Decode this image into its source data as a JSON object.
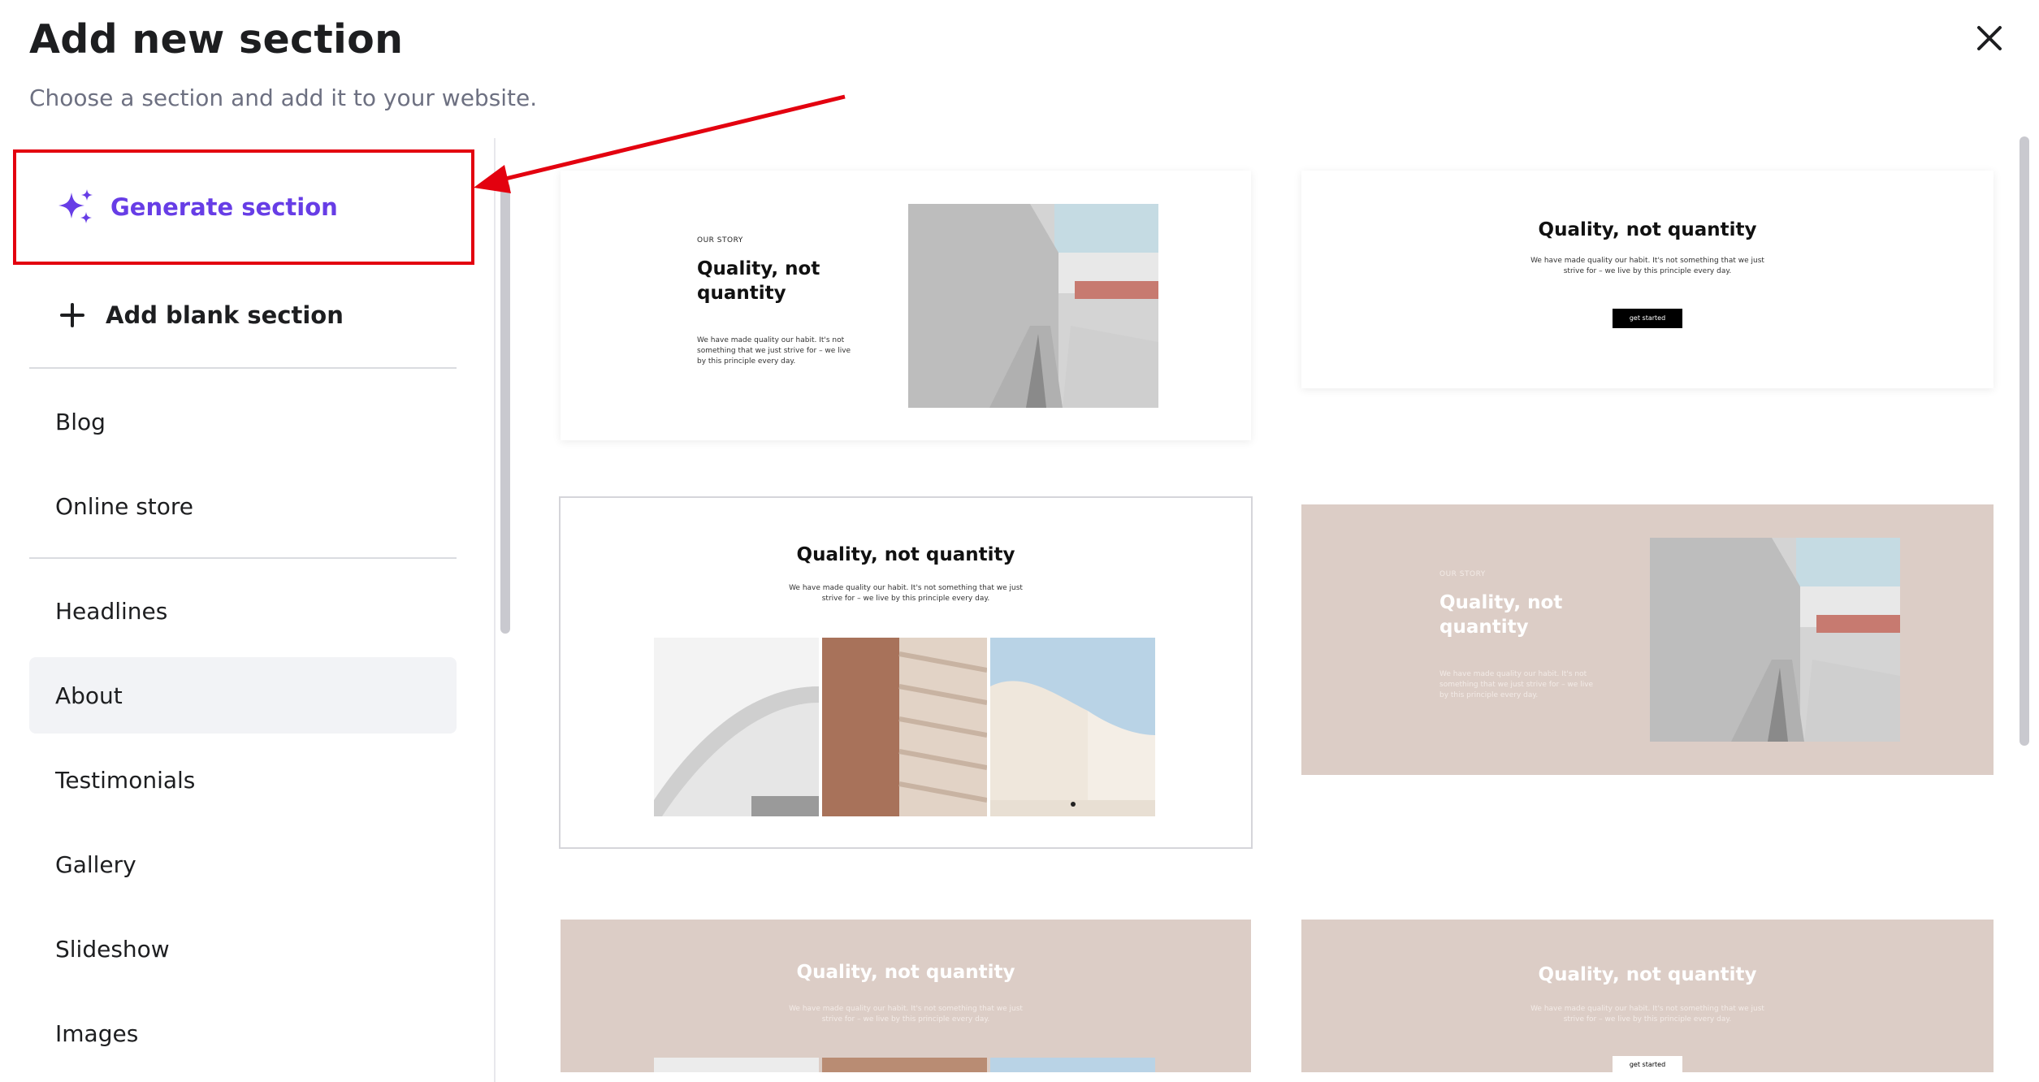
{
  "header": {
    "title": "Add new section",
    "subtitle": "Choose a section and add it to your website."
  },
  "sidebar": {
    "generate_label": "Generate section",
    "blank_label": "Add blank section",
    "categories_group1": [
      "Blog",
      "Online store"
    ],
    "categories_group2": [
      "Headlines",
      "About",
      "Testimonials",
      "Gallery",
      "Slideshow",
      "Images"
    ],
    "active_category": "About"
  },
  "templates": {
    "eyebrow": "OUR STORY",
    "heading_two_line": "Quality, not\nquantity",
    "heading": "Quality, not quantity",
    "body_left": "We have made quality our habit. It's not something that we just strive for – we live by this principle every day.",
    "body_center": "We have made quality our habit. It's not something that we just strive for – we live by this principle every day.",
    "button": "get started"
  },
  "colors": {
    "accent": "#673de6",
    "highlight": "#e3010f",
    "pink": "#dccdc6",
    "active_bg": "#f2f3f6"
  },
  "icons": [
    "close-icon",
    "sparkles-icon",
    "plus-icon"
  ]
}
